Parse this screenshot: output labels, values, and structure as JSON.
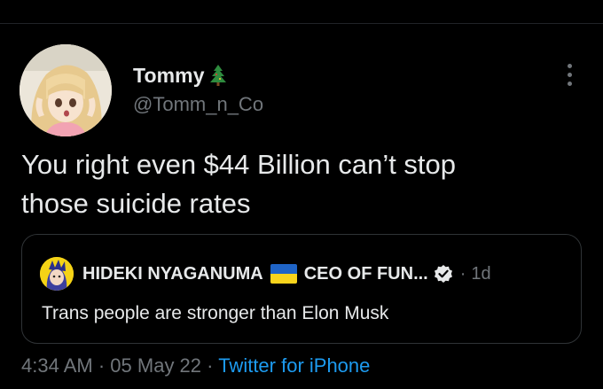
{
  "author": {
    "display_name": "Tommy",
    "name_emoji": "evergreen-tree-icon",
    "handle": "@Tomm_n_Co"
  },
  "tweet": {
    "text_line1": "You right even $44 Billion can’t stop",
    "text_line2": "those suicide rates"
  },
  "quoted": {
    "name_part1": "HIDEKI NYAGANUMA",
    "flag": "ukraine-flag-icon",
    "name_part2": "CEO OF FUN...",
    "verified": true,
    "separator": "·",
    "time": "1d",
    "text": "Trans people are stronger than Elon Musk"
  },
  "meta": {
    "time": "4:34 AM",
    "dot1": "·",
    "date": "05 May 22",
    "dot2": "·",
    "source": "Twitter for iPhone"
  },
  "colors": {
    "background": "#000000",
    "primary_text": "#e7e9ea",
    "secondary_text": "#71767b",
    "link": "#1d9bf0",
    "border": "#2f3336"
  }
}
